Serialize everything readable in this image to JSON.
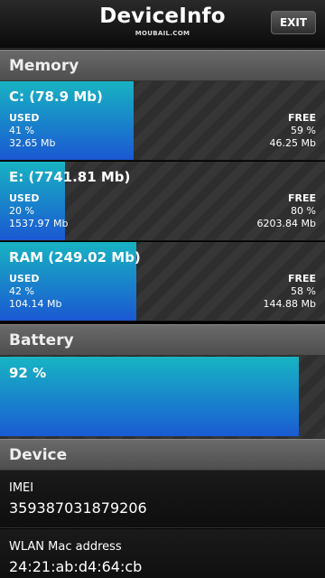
{
  "header": {
    "title": "DeviceInfo",
    "subtitle": "MOUBAIL.COM",
    "exit_label": "EXIT"
  },
  "sections": {
    "memory": "Memory",
    "battery": "Battery",
    "device": "Device"
  },
  "memory": [
    {
      "title": "C: (78.9 Mb)",
      "used_label": "USED",
      "used_percent": "41 %",
      "used_amount": "32.65 Mb",
      "free_label": "FREE",
      "free_percent": "59 %",
      "free_amount": "46.25 Mb",
      "used_fraction": 0.41
    },
    {
      "title": "E: (7741.81 Mb)",
      "used_label": "USED",
      "used_percent": "20 %",
      "used_amount": "1537.97 Mb",
      "free_label": "FREE",
      "free_percent": "80 %",
      "free_amount": "6203.84 Mb",
      "used_fraction": 0.2
    },
    {
      "title": "RAM (249.02 Mb)",
      "used_label": "USED",
      "used_percent": "42 %",
      "used_amount": "104.14 Mb",
      "free_label": "FREE",
      "free_percent": "58 %",
      "free_amount": "144.88 Mb",
      "used_fraction": 0.42
    }
  ],
  "battery": {
    "level_text": "92 %",
    "level_fraction": 0.92
  },
  "device": {
    "imei_label": "IMEI",
    "imei_value": "359387031879206",
    "wlan_label": "WLAN Mac address",
    "wlan_value": "24:21:ab:d4:64:cb"
  },
  "colors": {
    "fill_top": "#18b3c2",
    "fill_bottom": "#1a58d2"
  }
}
